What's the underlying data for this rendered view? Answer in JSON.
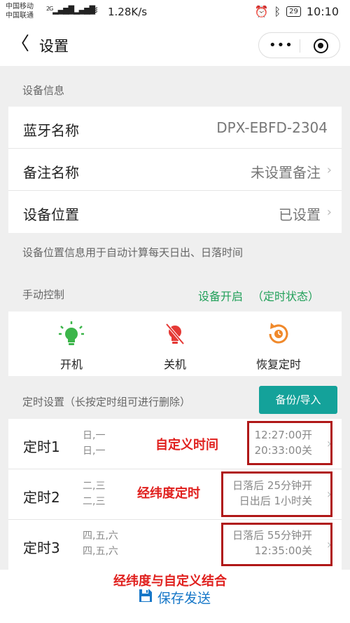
{
  "status_bar": {
    "carrier1": "中国移动",
    "carrier2": "中国联通",
    "sig1": "2G",
    "sig2": "4G",
    "speed": "1.28K/s",
    "battery": "29",
    "time": "10:10"
  },
  "nav": {
    "back_glyph": "〈",
    "title": "设置",
    "more_glyph": "•••"
  },
  "device_info": {
    "section_label": "设备信息",
    "rows": [
      {
        "label": "蓝牙名称",
        "value": "DPX-EBFD-2304"
      },
      {
        "label": "备注名称",
        "value": "未设置备注"
      },
      {
        "label": "设备位置",
        "value": "已设置"
      }
    ],
    "note": "设备位置信息用于自动计算每天日出、日落时间"
  },
  "manual": {
    "section_label": "手动控制",
    "status_on": "设备开启",
    "status_mode": "（定时状态）",
    "buttons": [
      {
        "label": "开机",
        "icon": "bulb-on-icon"
      },
      {
        "label": "关机",
        "icon": "bulb-off-icon"
      },
      {
        "label": "恢复定时",
        "icon": "restore-timer-icon"
      }
    ]
  },
  "timers": {
    "section_label": "定时设置（长按定时组可进行删除）",
    "backup_label": "备份/导入",
    "items": [
      {
        "name": "定时1",
        "days1": "日,一",
        "days2": "日,一",
        "time1": "12:27:00开",
        "time2": "20:33:00关",
        "annotation": "自定义时间"
      },
      {
        "name": "定时2",
        "days1": "二,三",
        "days2": "二,三",
        "time1": "日落后 25分钟开",
        "time2": "日出后 1小时关",
        "annotation": "经纬度定时"
      },
      {
        "name": "定时3",
        "days1": "四,五,六",
        "days2": "四,五,六",
        "time1": "日落后 55分钟开",
        "time2": "12:35:00关",
        "annotation": "经纬度与自定义结合"
      }
    ]
  },
  "save_label": "保存发送",
  "colors": {
    "accent": "#14a29a",
    "status_green": "#22a05a",
    "annotation_red": "#e0201e",
    "save_blue": "#1677c8"
  }
}
